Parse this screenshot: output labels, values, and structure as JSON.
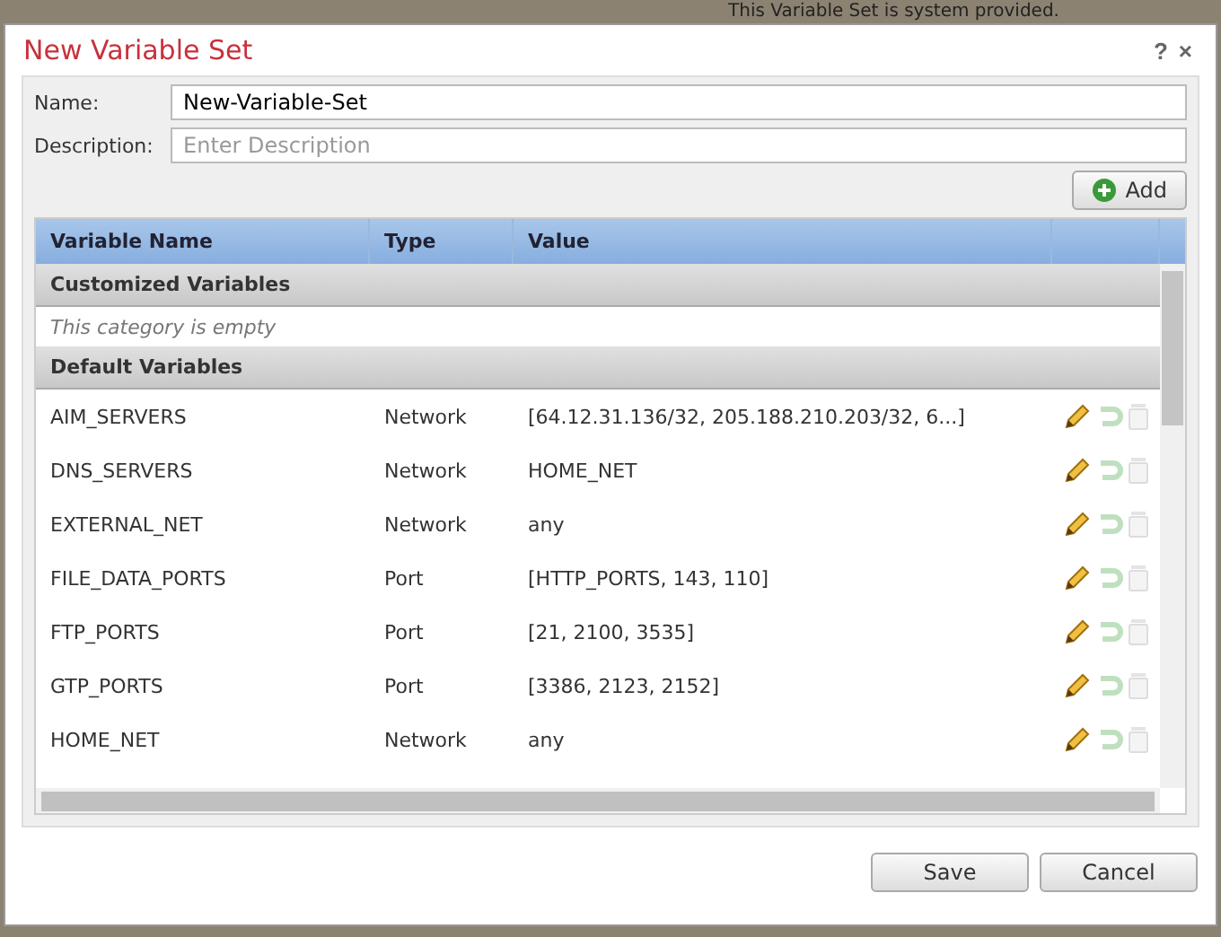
{
  "background_text": "This Variable Set is system provided.",
  "window": {
    "title": "New Variable Set",
    "help": "?",
    "close": "×"
  },
  "form": {
    "name_label": "Name:",
    "name_value": "New-Variable-Set",
    "description_label": "Description:",
    "description_placeholder": "Enter Description"
  },
  "add_button": "Add",
  "table": {
    "columns": [
      "Variable Name",
      "Type",
      "Value"
    ],
    "groups": [
      {
        "title": "Customized Variables",
        "empty_text": "This category is empty"
      },
      {
        "title": "Default Variables",
        "rows": [
          {
            "name": "AIM_SERVERS",
            "type": "Network",
            "value": "[64.12.31.136/32, 205.188.210.203/32, 6...]"
          },
          {
            "name": "DNS_SERVERS",
            "type": "Network",
            "value": "HOME_NET"
          },
          {
            "name": "EXTERNAL_NET",
            "type": "Network",
            "value": "any"
          },
          {
            "name": "FILE_DATA_PORTS",
            "type": "Port",
            "value": "[HTTP_PORTS, 143, 110]"
          },
          {
            "name": "FTP_PORTS",
            "type": "Port",
            "value": "[21, 2100, 3535]"
          },
          {
            "name": "GTP_PORTS",
            "type": "Port",
            "value": "[3386, 2123, 2152]"
          },
          {
            "name": "HOME_NET",
            "type": "Network",
            "value": "any"
          }
        ]
      }
    ]
  },
  "buttons": [
    "Save",
    "Cancel"
  ]
}
